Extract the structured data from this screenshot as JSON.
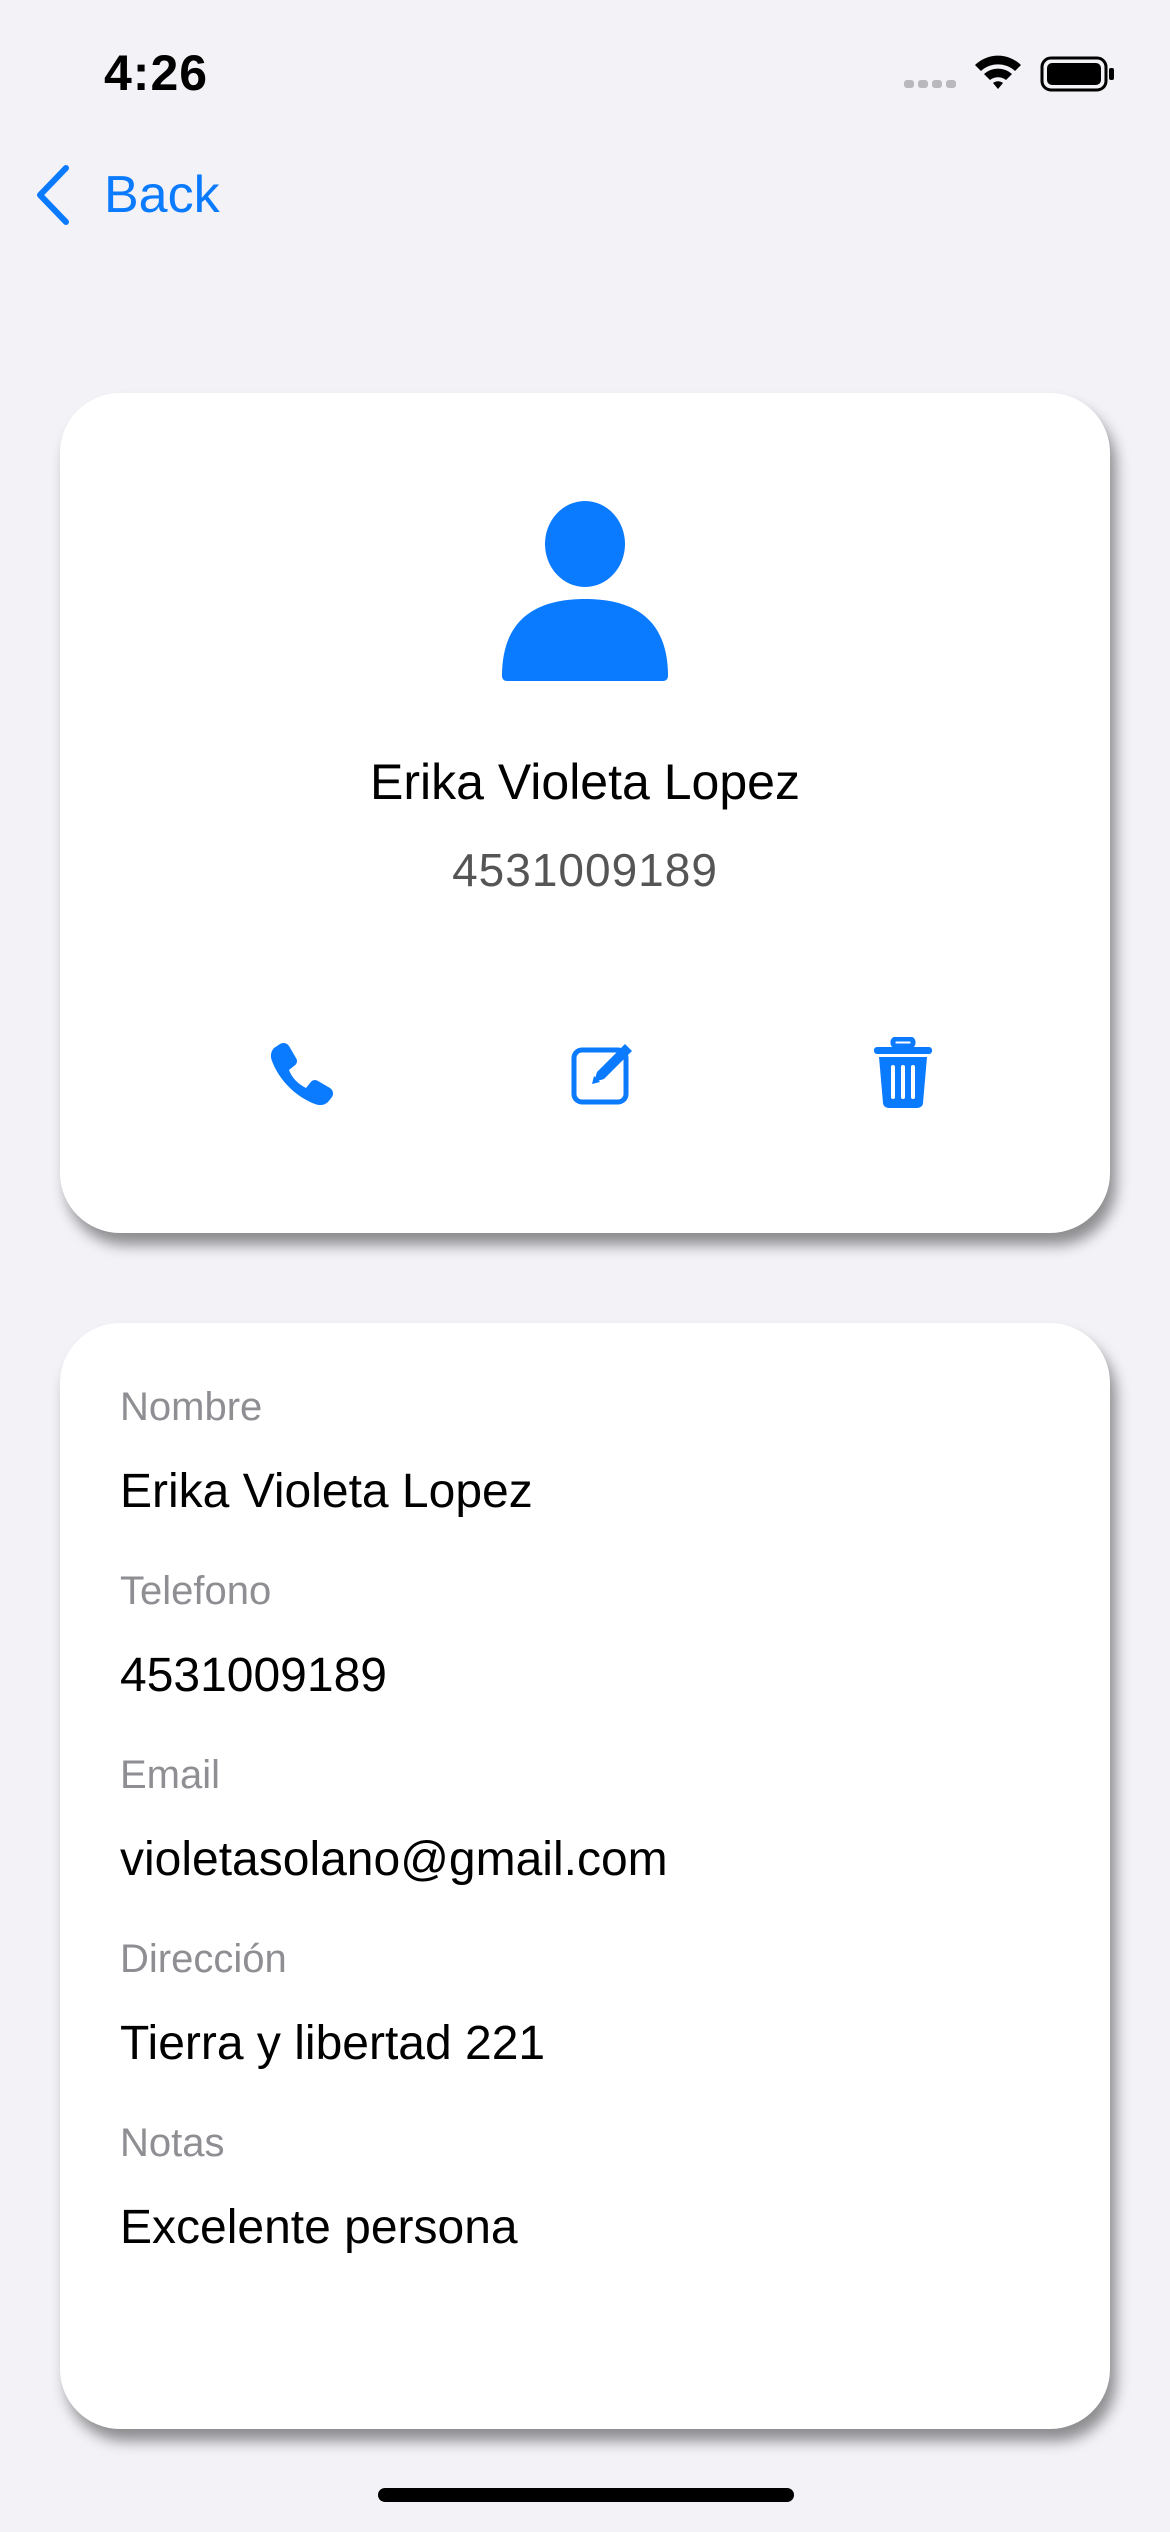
{
  "status_bar": {
    "time": "4:26"
  },
  "nav": {
    "back_label": "Back",
    "accent_color": "#0A7AFF"
  },
  "contact": {
    "icon": "person-icon",
    "name": "Erika Violeta Lopez",
    "phone": "4531009189",
    "actions": [
      "phone-icon",
      "edit-icon",
      "trash-icon"
    ]
  },
  "details": {
    "fields": [
      {
        "label": "Nombre",
        "value": "Erika Violeta Lopez"
      },
      {
        "label": "Telefono",
        "value": "4531009189"
      },
      {
        "label": "Email",
        "value": "violetasolano@gmail.com"
      },
      {
        "label": "Dirección",
        "value": "Tierra y libertad 221"
      },
      {
        "label": "Notas",
        "value": "Excelente persona"
      }
    ]
  }
}
